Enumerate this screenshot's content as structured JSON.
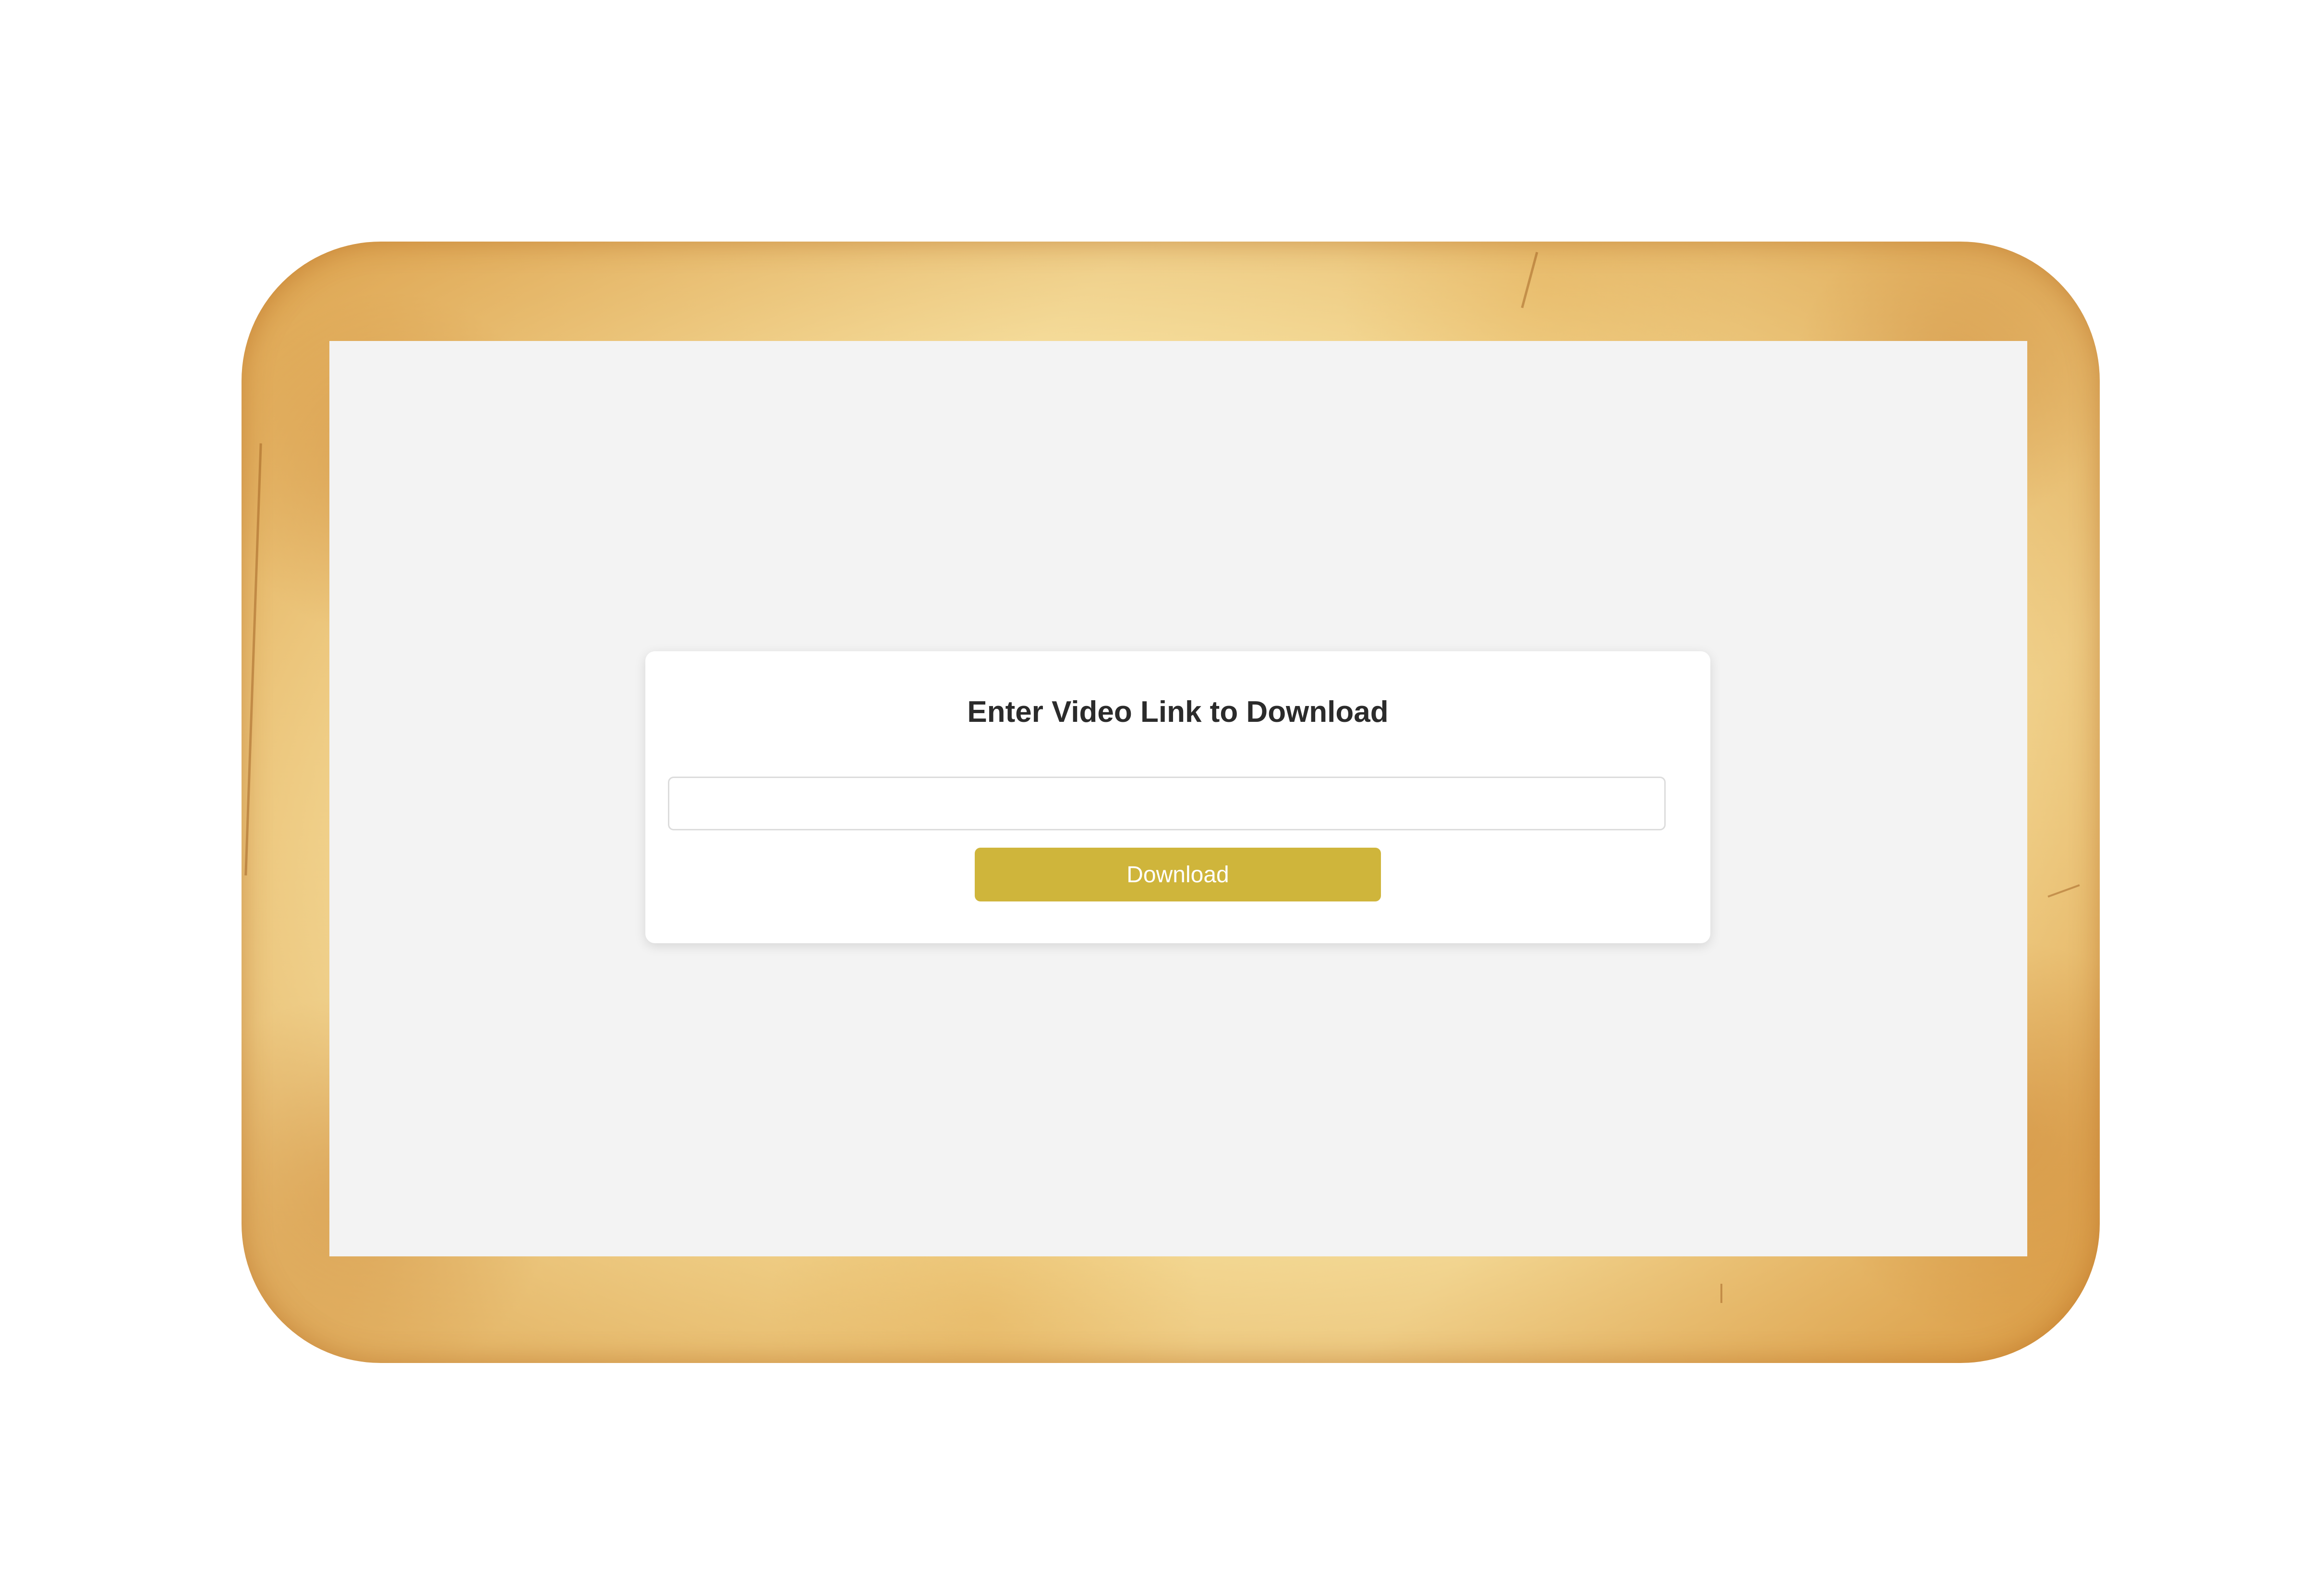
{
  "form": {
    "title": "Enter Video Link to Download",
    "input_value": "",
    "input_placeholder": "",
    "button_label": "Download"
  },
  "colors": {
    "button_bg": "#cfb53b",
    "content_bg": "#f3f3f3",
    "card_bg": "#ffffff",
    "frame": "parchment"
  }
}
